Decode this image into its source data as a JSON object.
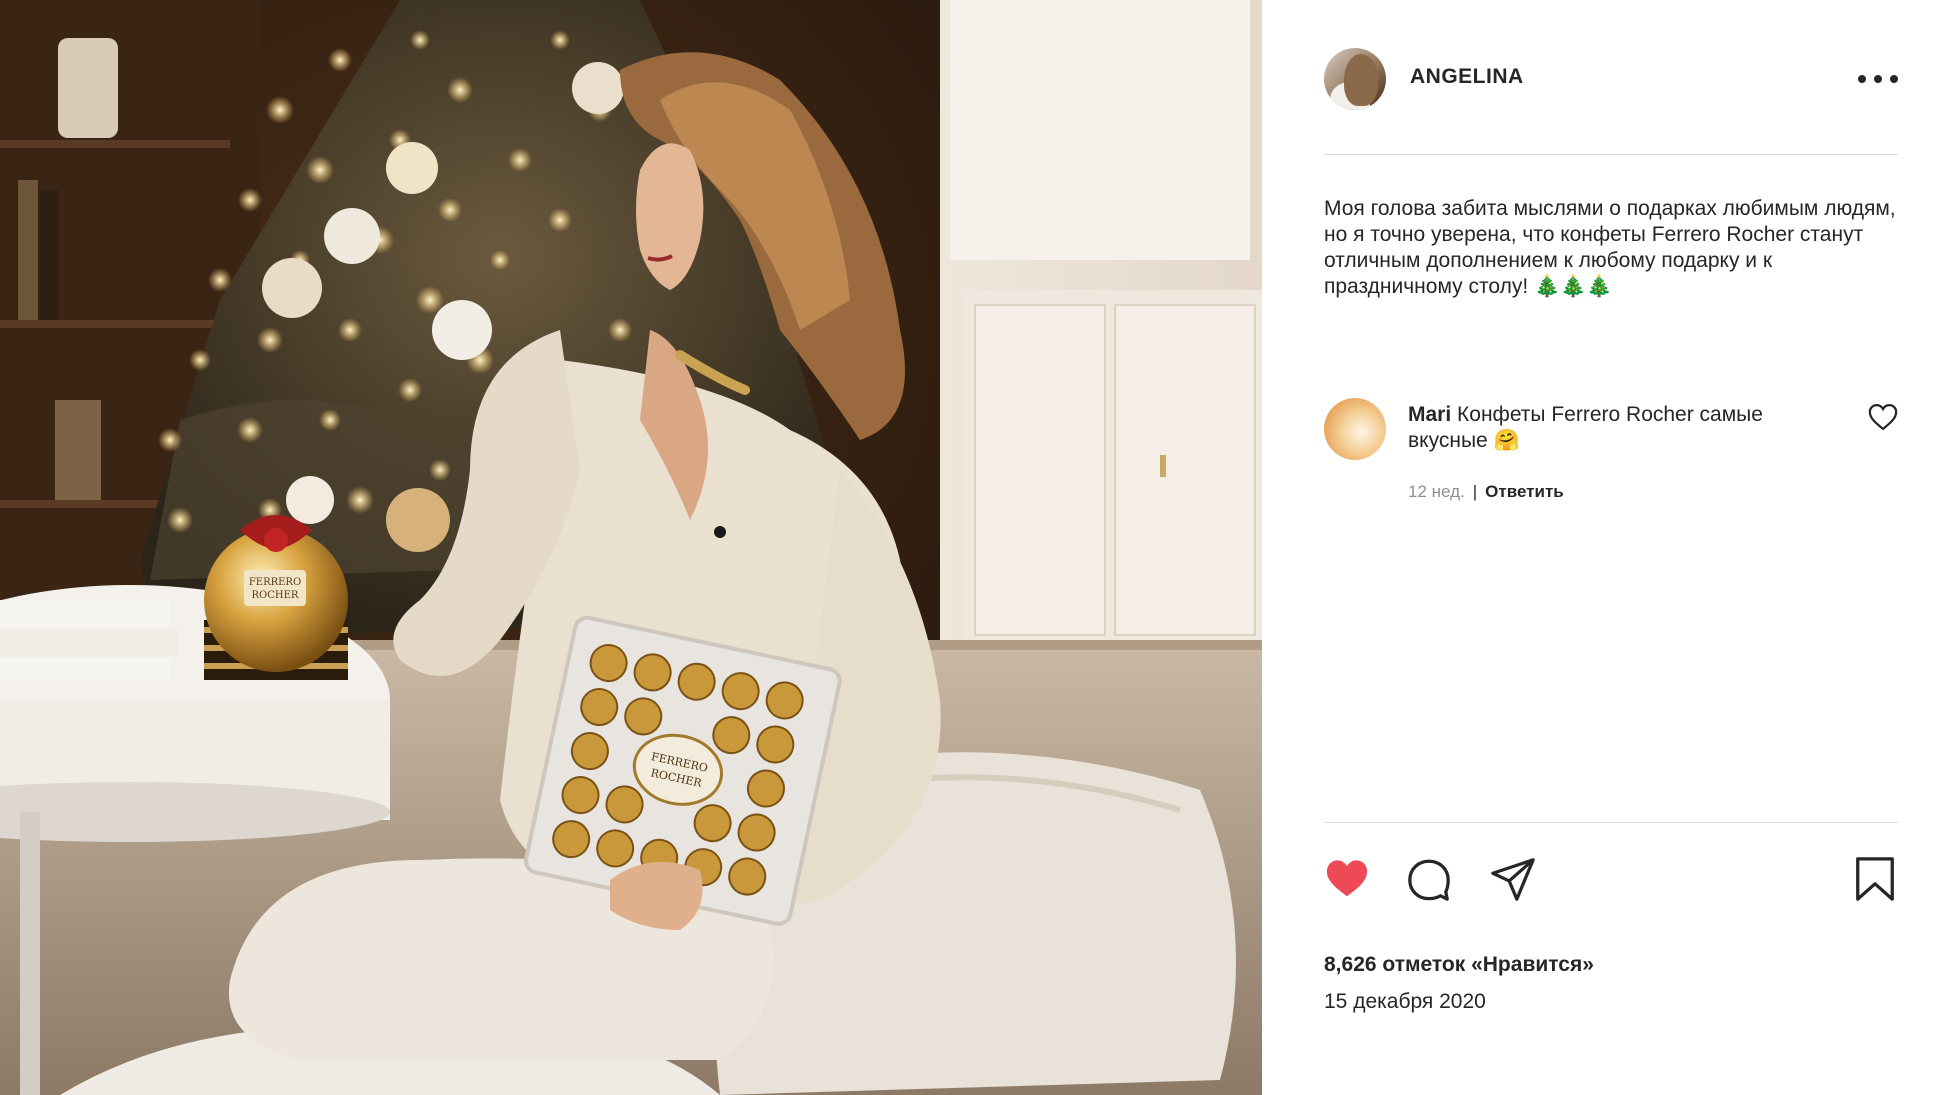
{
  "post": {
    "username": "ANGELINA",
    "caption": "Моя голова забита мыслями о подарках любимым людям, но я точно уверена, что конфеты Ferrero Rocher станут отличным дополнением к любому подарку и к праздничному столу! 🎄🎄🎄",
    "likes_text": "8,626 отметок «Нравится»",
    "date": "15 декабря 2020",
    "liked": true
  },
  "comment": {
    "username": "Mari",
    "text": "Конфеты Ferrero Rocher самые вкусные 🤗",
    "time": "12 нед.",
    "reply_label": "Ответить"
  },
  "photo": {
    "brand_label_line1": "FERRERO",
    "brand_label_line2": "ROCHER"
  },
  "colors": {
    "like_active": "#ed4956",
    "text": "#262626",
    "muted": "#8e8e8e",
    "divider": "#dbdbdb"
  },
  "icons": {
    "more": "ellipsis-icon",
    "like": "heart-filled-icon",
    "comment": "speech-bubble-icon",
    "share": "paper-plane-icon",
    "save": "bookmark-icon",
    "comment_like": "heart-outline-icon"
  }
}
